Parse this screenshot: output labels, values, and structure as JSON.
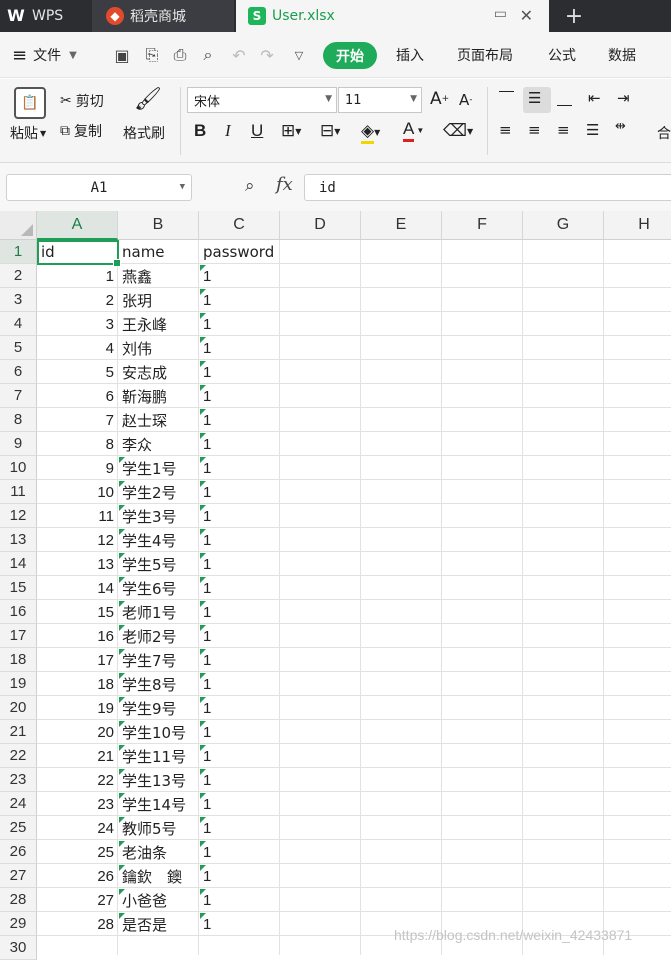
{
  "titlebar": {
    "tabs": [
      {
        "label": "WPS",
        "icon": "wps-logo-icon"
      },
      {
        "label": "稻壳商城",
        "icon": "docer-store-icon"
      },
      {
        "label": "User.xlsx",
        "icon": "spreadsheet-file-icon"
      }
    ],
    "new_tab": "+"
  },
  "menubar": {
    "file_menu": "文件",
    "start": "开始",
    "items": [
      "插入",
      "页面布局",
      "公式",
      "数据"
    ]
  },
  "ribbon": {
    "paste": "粘贴",
    "cut": "剪切",
    "copy": "复制",
    "format_painter": "格式刷",
    "font_name": "宋体",
    "font_size": "11",
    "bold": "B",
    "italic": "I",
    "underline": "U",
    "font_color": "A",
    "merge_partial": "合"
  },
  "formula": {
    "name_box": "A1",
    "fx": "fx",
    "content": "id"
  },
  "columns": [
    "A",
    "B",
    "C",
    "D",
    "E",
    "F",
    "G",
    "H"
  ],
  "row_numbers": [
    "1",
    "2",
    "3",
    "4",
    "5",
    "6",
    "7",
    "8",
    "9",
    "10",
    "11",
    "12",
    "13",
    "14",
    "15",
    "16",
    "17",
    "18",
    "19",
    "20",
    "21",
    "22",
    "23",
    "24",
    "25",
    "26",
    "27",
    "28",
    "29",
    "30"
  ],
  "header_row": {
    "a": "id",
    "b": "name",
    "c": "password"
  },
  "rows": [
    {
      "id": "1",
      "name": "燕鑫",
      "password": "1"
    },
    {
      "id": "2",
      "name": "张玥",
      "password": "1"
    },
    {
      "id": "3",
      "name": "王永峰",
      "password": "1"
    },
    {
      "id": "4",
      "name": "刘伟",
      "password": "1"
    },
    {
      "id": "5",
      "name": "安志成",
      "password": "1"
    },
    {
      "id": "6",
      "name": "靳海鹏",
      "password": "1"
    },
    {
      "id": "7",
      "name": "赵士琛",
      "password": "1"
    },
    {
      "id": "8",
      "name": "李众",
      "password": "1"
    },
    {
      "id": "9",
      "name": "学生1号",
      "password": "1"
    },
    {
      "id": "10",
      "name": "学生2号",
      "password": "1"
    },
    {
      "id": "11",
      "name": "学生3号",
      "password": "1"
    },
    {
      "id": "12",
      "name": "学生4号",
      "password": "1"
    },
    {
      "id": "13",
      "name": "学生5号",
      "password": "1"
    },
    {
      "id": "14",
      "name": "学生6号",
      "password": "1"
    },
    {
      "id": "15",
      "name": "老师1号",
      "password": "1"
    },
    {
      "id": "16",
      "name": "老师2号",
      "password": "1"
    },
    {
      "id": "17",
      "name": "学生7号",
      "password": "1"
    },
    {
      "id": "18",
      "name": "学生8号",
      "password": "1"
    },
    {
      "id": "19",
      "name": "学生9号",
      "password": "1"
    },
    {
      "id": "20",
      "name": "学生10号",
      "password": "1"
    },
    {
      "id": "21",
      "name": "学生11号",
      "password": "1"
    },
    {
      "id": "22",
      "name": "学生13号",
      "password": "1"
    },
    {
      "id": "23",
      "name": "学生14号",
      "password": "1"
    },
    {
      "id": "24",
      "name": "教师5号",
      "password": "1"
    },
    {
      "id": "25",
      "name": "老油条",
      "password": "1"
    },
    {
      "id": "26",
      "name": "鑰欽　鐭",
      "password": "1"
    },
    {
      "id": "27",
      "name": "小爸爸",
      "password": "1"
    },
    {
      "id": "28",
      "name": "是否是",
      "password": "1"
    }
  ],
  "watermark": "https://blog.csdn.net/weixin_42433871",
  "colors": {
    "accent": "#1fab5a",
    "titlebar": "#2b2d31",
    "file_tab_text": "#1a9e4e"
  }
}
